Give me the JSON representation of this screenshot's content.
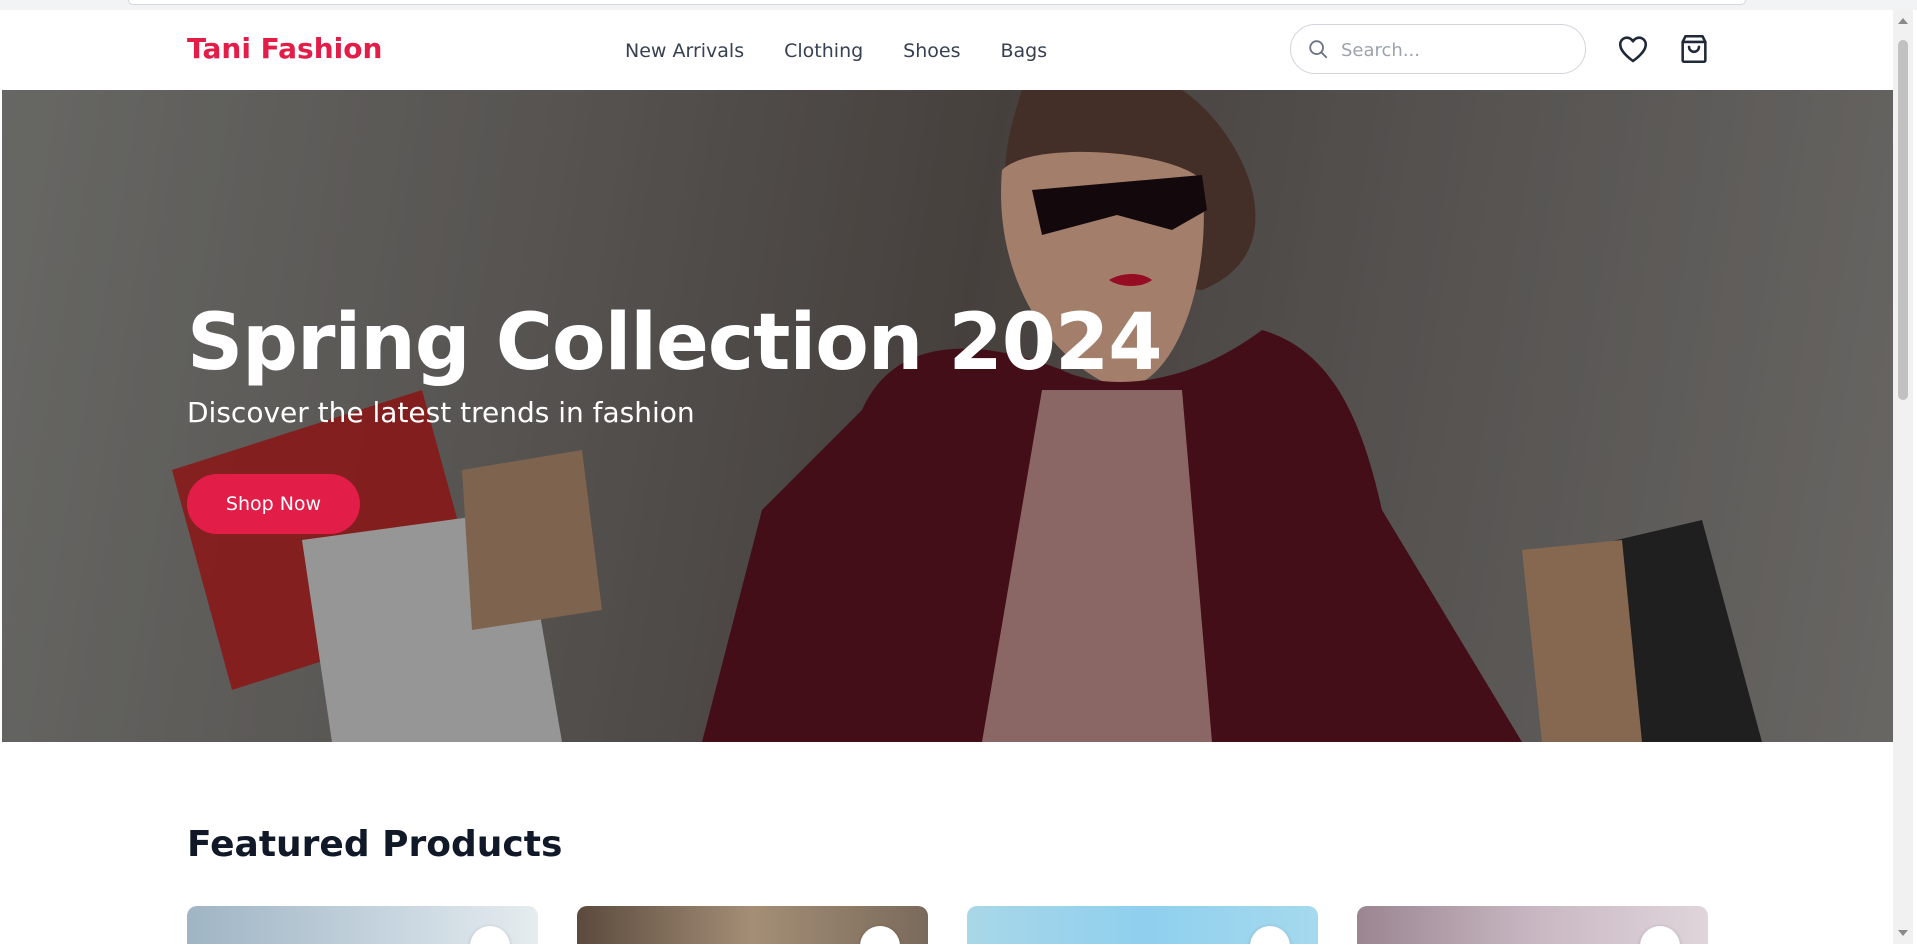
{
  "header": {
    "logo": "Tani Fashion",
    "nav": [
      "New Arrivals",
      "Clothing",
      "Shoes",
      "Bags"
    ],
    "search_placeholder": "Search...",
    "icons": [
      "heart-icon",
      "shopping-bag-icon",
      "search-icon"
    ]
  },
  "hero": {
    "title": "Spring Collection 2024",
    "subtitle": "Discover the latest trends in fashion",
    "cta": "Shop Now"
  },
  "featured": {
    "title": "Featured Products"
  },
  "colors": {
    "accent": "#e11d48",
    "heading": "#111827",
    "nav_text": "#374151"
  }
}
